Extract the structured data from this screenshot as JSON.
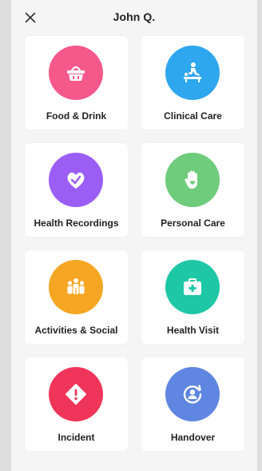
{
  "header": {
    "title": "John Q.",
    "close_icon": "close-icon"
  },
  "tiles": [
    {
      "label": "Food & Drink",
      "icon": "food-basket-icon",
      "color": "#f5588a"
    },
    {
      "label": "Clinical Care",
      "icon": "clinical-care-icon",
      "color": "#2ea7ef"
    },
    {
      "label": "Health Recordings",
      "icon": "heart-check-icon",
      "color": "#9a5ef5"
    },
    {
      "label": "Personal Care",
      "icon": "hand-heart-icon",
      "color": "#6fcc7c"
    },
    {
      "label": "Activities & Social",
      "icon": "group-people-icon",
      "color": "#f5a623"
    },
    {
      "label": "Health Visit",
      "icon": "medical-kit-icon",
      "color": "#1ec7a5"
    },
    {
      "label": "Incident",
      "icon": "warning-icon",
      "color": "#f0355a"
    },
    {
      "label": "Handover",
      "icon": "handover-user-icon",
      "color": "#5f86e0"
    }
  ]
}
